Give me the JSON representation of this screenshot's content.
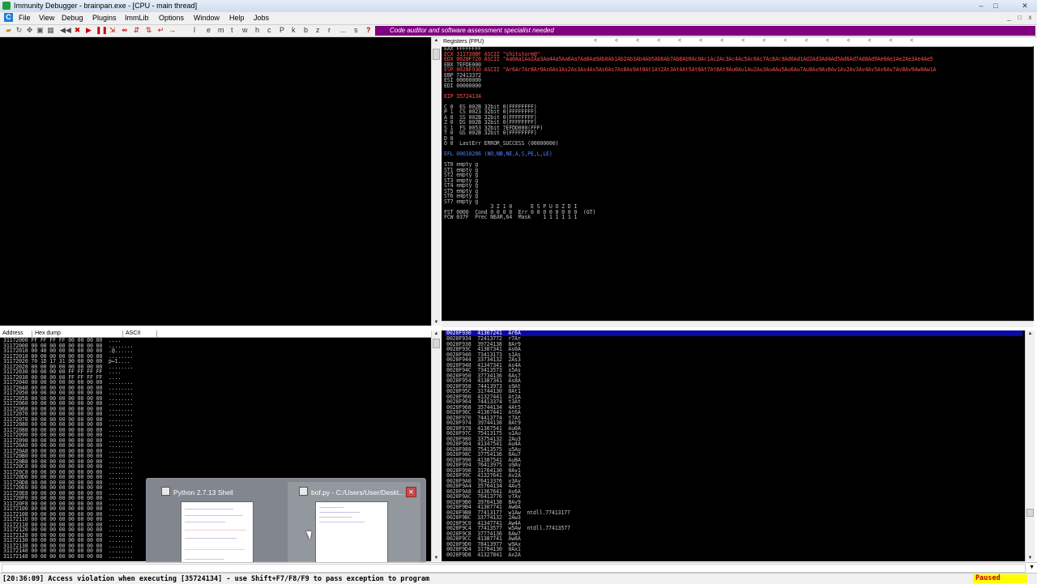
{
  "window": {
    "title": "Immunity Debugger - brainpan.exe - [CPU - main thread]",
    "controls": [
      "–",
      "□",
      "✕"
    ]
  },
  "menu": {
    "app_icon": "C",
    "items": [
      "File",
      "View",
      "Debug",
      "Plugins",
      "ImmLib",
      "Options",
      "Window",
      "Help",
      "Jobs"
    ],
    "mdi_controls": [
      "_",
      "□",
      "x"
    ]
  },
  "toolbar": {
    "letters": [
      "l",
      "e",
      "m",
      "t",
      "w",
      "h",
      "c",
      "P",
      "k",
      "b",
      "z",
      "r",
      "...",
      "s",
      "?"
    ],
    "banner": "Code auditor and software assessment specialist needed"
  },
  "registers": {
    "header": "Registers (FPU)",
    "header_arrows": "< < < < < < < < < < < < < < < <",
    "lines": [
      "EAX FFFFFFFF",
      "ECX 311730BF ASCII \"shitstorm@\"",
      "EDX 0028F720 ASCII \"Aa0Aa1Aa2Aa3Aa4Aa5Aa6Aa7Aa8Aa9Ab0Ab1Ab2Ab3Ab4Ab5Ab6Ab7Ab8Ab9Ac0Ac1Ac2Ac3Ac4Ac5Ac6Ac7Ac8Ac9Ad0Ad1Ad2Ad3Ad4Ad5Ad6Ad7Ad8Ad9Ae0Ae1Ae2Ae3Ae4Ae5",
      "EBX 7EFDE000",
      "ESP 0028F930 ASCII \"Ar6Ar7Ar8Ar9As0As1As2As3As4As5As6As7As8As9At0At1At2At3At4At5At6At7At8At9Au0Au1Au2Au3Au4Au5Au6Au7Au8Au9Av0Av1Av2Av3Av4Av5Av6Av7Av8Av9Aw0Aw1A",
      "EBP 72413372",
      "ESI 00000000",
      "EDI 00000000",
      "",
      "EIP 35724134",
      "",
      "C 0  ES 002B 32bit 0(FFFFFFFF)",
      "P 1  CS 0023 32bit 0(FFFFFFFF)",
      "A 0  SS 002B 32bit 0(FFFFFFFF)",
      "Z 0  DS 002B 32bit 0(FFFFFFFF)",
      "S 1  FS 0053 32bit 7EFDD000(FFF)",
      "T 0  GS 002B 32bit 0(FFFFFFFF)",
      "D 0",
      "O 0  LastErr ERROR_SUCCESS (00000000)",
      "",
      "EFL 00010286 (NO,NB,NE,A,S,PE,L,LE)",
      "",
      "ST0 empty g",
      "ST1 empty g",
      "ST2 empty g",
      "ST3 empty g",
      "ST4 empty g",
      "ST5 empty g",
      "ST6 empty g",
      "ST7 empty g",
      "               3 2 1 0      E S P U O Z D I",
      "FST 0000  Cond 0 0 0 0  Err 0 0 0 0 0 0 0 0  (GT)",
      "FCW 037F  Prec NEAR,64  Mask    1 1 1 1 1 1"
    ]
  },
  "dump": {
    "headers": [
      "Address",
      "Hex dump",
      "ASCII"
    ],
    "lines": [
      "31172000 FF FF FF FF 00 00 00 00  ....",
      "31172008 00 00 00 00 00 00 00 00  ........",
      "31172010 00 40 00 00 00 00 00 00  .@......",
      "31172018 00 00 00 00 00 00 00 00  ........",
      "31172020 70 1D 17 31 00 00 00 00  p↔1....",
      "31172028 00 00 00 00 00 00 00 00  ........",
      "31172030 00 00 00 00 FF FF FF FF  ....",
      "31172038 00 00 00 00 FF FF FF FF  ....",
      "31172040 00 00 00 00 00 00 00 00  ........",
      "31172048 00 00 00 00 00 00 00 00  ........",
      "31172050 00 00 00 00 00 00 00 00  ........",
      "31172058 00 00 00 00 00 00 00 00  ........",
      "31172060 00 00 00 00 00 00 00 00  ........",
      "31172068 00 00 00 00 00 00 00 00  ........",
      "31172070 00 00 00 00 00 00 00 00  ........",
      "31172078 00 00 00 00 00 00 00 00  ........",
      "31172080 00 00 00 00 00 00 00 00  ........",
      "31172088 00 00 00 00 00 00 00 00  ........",
      "31172090 00 00 00 00 00 00 00 00  ........",
      "31172098 00 00 00 00 00 00 00 00  ........",
      "311720A0 00 00 00 00 00 00 00 00  ........",
      "311720A8 00 00 00 00 00 00 00 00  ........",
      "311720B0 00 00 00 00 00 00 00 00  ........",
      "311720B8 00 00 00 00 00 00 00 00  ........",
      "311720C0 00 00 00 00 00 00 00 00  ........",
      "311720C8 00 00 00 00 00 00 00 00  ........",
      "311720D0 00 00 00 00 00 00 00 00  ........",
      "311720D8 00 00 00 00 00 00 00 00  ........",
      "311720E0 00 00 00 00 00 00 00 00  ........",
      "311720E8 00 00 00 00 00 00 00 00  ........",
      "311720F0 00 00 00 00 00 00 00 00  ........",
      "311720F8 00 00 00 00 00 00 00 00  ........",
      "31172100 00 00 00 00 00 00 00 00  ........",
      "31172108 00 00 00 00 00 00 00 00  ........",
      "31172110 00 00 00 00 00 00 00 00  ........",
      "31172118 00 00 00 00 00 00 00 00  ........",
      "31172120 00 00 00 00 00 00 00 00  ........",
      "31172128 00 00 00 00 00 00 00 00  ........",
      "31172130 00 00 00 00 00 00 00 00  ........",
      "31172138 00 00 00 00 00 00 00 00  ........",
      "31172140 00 00 00 00 00 00 00 00  ........",
      "31172148 00 00 00 00 00 00 00 00  ........"
    ]
  },
  "stack": {
    "selected": "0028F930  41367241  Ar6A",
    "lines": [
      "0028F934  72413772  r7Ar",
      "0028F938  39724138  8Ar9",
      "0028F93C  41307341  As0A",
      "0028F940  73413173  s1As",
      "0028F944  33734132  2As3",
      "0028F948  41347341  As4A",
      "0028F94C  73413573  s5As",
      "0028F950  37734136  6As7",
      "0028F954  41387341  As8A",
      "0028F958  74413973  s9At",
      "0028F95C  31744130  0At1",
      "0028F960  41327441  At2A",
      "0028F964  74413374  t3At",
      "0028F968  35744134  4At5",
      "0028F96C  41367441  At6A",
      "0028F970  74413774  t7At",
      "0028F974  39744138  8At9",
      "0028F978  41307541  Au0A",
      "0028F97C  75413175  u1Au",
      "0028F980  33754132  2Au3",
      "0028F984  41347541  Au4A",
      "0028F988  75413575  u5Au",
      "0028F98C  37754136  6Au7",
      "0028F990  41387541  Au8A",
      "0028F994  76413975  u9Av",
      "0028F998  31764130  0Av1",
      "0028F99C  41327641  Av2A",
      "0028F9A0  76413376  v3Av",
      "0028F9A4  35764134  4Av5",
      "0028F9A8  41367641  Av6A",
      "0028F9AC  76413776  v7Av",
      "0028F9B0  39764138  8Av9",
      "0028F9B4  41307741  Aw0A",
      "0028F9B8  77413177  w1Aw  ntdll.77413177",
      "0028F9BC  33774132  2Aw3",
      "0028F9C0  41347741  Aw4A",
      "0028F9C4  77413577  w5Aw  ntdll.77413577",
      "0028F9C8  37774136  6Aw7",
      "0028F9CC  41387741  Aw8A",
      "0028F9D0  78413977  w9Ax",
      "0028F9D4  31784130  0Ax1",
      "0028F9D8  41327841  Ax2A"
    ]
  },
  "thumbnails": [
    {
      "title": "Python 2.7.13 Shell"
    },
    {
      "title": "bof.py - C:/Users/User/Deskt..."
    }
  ],
  "status": {
    "message": "[20:36:09] Access violation when executing [35724134] - use Shift+F7/F8/F9 to pass exception to program",
    "state": "Paused"
  }
}
